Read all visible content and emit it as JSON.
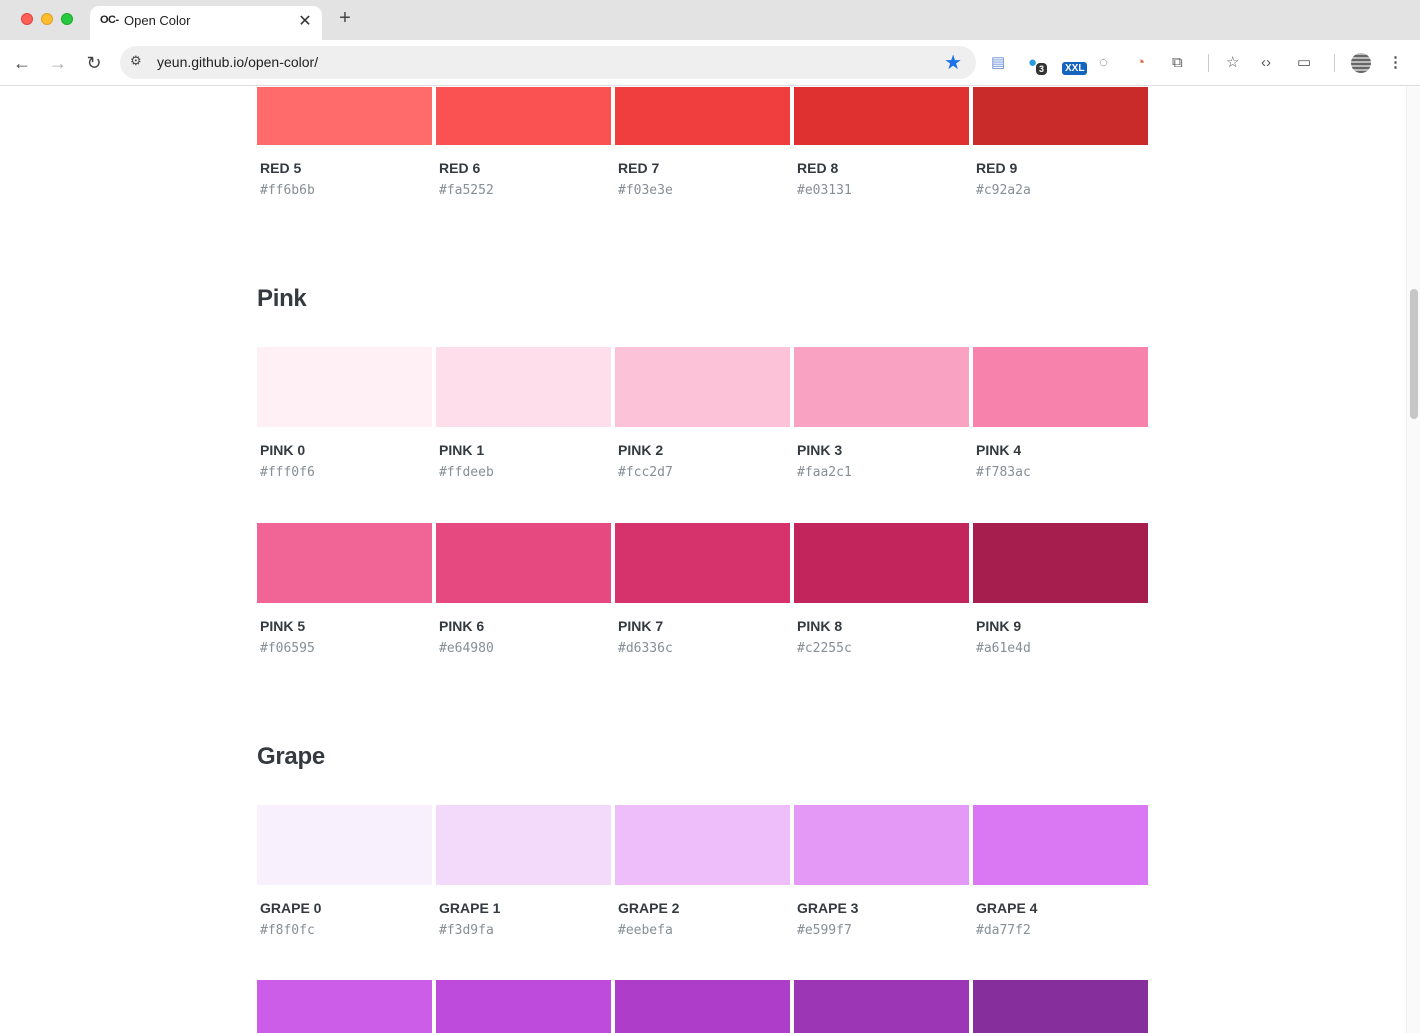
{
  "browser": {
    "tab_title": "Open Color",
    "tab_favicon": "OC-",
    "url": "yeun.github.io/open-color/",
    "ext_badge_count": "3",
    "ext_badge_label": "XXL"
  },
  "sections": [
    {
      "title": "",
      "rows": [
        [
          {
            "name": "RED 5",
            "hex": "#ff6b6b"
          },
          {
            "name": "RED 6",
            "hex": "#fa5252"
          },
          {
            "name": "RED 7",
            "hex": "#f03e3e"
          },
          {
            "name": "RED 8",
            "hex": "#e03131"
          },
          {
            "name": "RED 9",
            "hex": "#c92a2a"
          }
        ]
      ]
    },
    {
      "title": "Pink",
      "rows": [
        [
          {
            "name": "PINK 0",
            "hex": "#fff0f6"
          },
          {
            "name": "PINK 1",
            "hex": "#ffdeeb"
          },
          {
            "name": "PINK 2",
            "hex": "#fcc2d7"
          },
          {
            "name": "PINK 3",
            "hex": "#faa2c1"
          },
          {
            "name": "PINK 4",
            "hex": "#f783ac"
          }
        ],
        [
          {
            "name": "PINK 5",
            "hex": "#f06595"
          },
          {
            "name": "PINK 6",
            "hex": "#e64980"
          },
          {
            "name": "PINK 7",
            "hex": "#d6336c"
          },
          {
            "name": "PINK 8",
            "hex": "#c2255c"
          },
          {
            "name": "PINK 9",
            "hex": "#a61e4d"
          }
        ]
      ]
    },
    {
      "title": "Grape",
      "rows": [
        [
          {
            "name": "GRAPE 0",
            "hex": "#f8f0fc"
          },
          {
            "name": "GRAPE 1",
            "hex": "#f3d9fa"
          },
          {
            "name": "GRAPE 2",
            "hex": "#eebefa"
          },
          {
            "name": "GRAPE 3",
            "hex": "#e599f7"
          },
          {
            "name": "GRAPE 4",
            "hex": "#da77f2"
          }
        ],
        [
          {
            "name": "",
            "hex": "#cc5de8",
            "label_hidden": true
          },
          {
            "name": "",
            "hex": "#be4bdb",
            "label_hidden": true
          },
          {
            "name": "",
            "hex": "#ae3ec9",
            "label_hidden": true
          },
          {
            "name": "",
            "hex": "#9c36b5",
            "label_hidden": true
          },
          {
            "name": "",
            "hex": "#862e9c",
            "label_hidden": true
          }
        ]
      ]
    }
  ]
}
